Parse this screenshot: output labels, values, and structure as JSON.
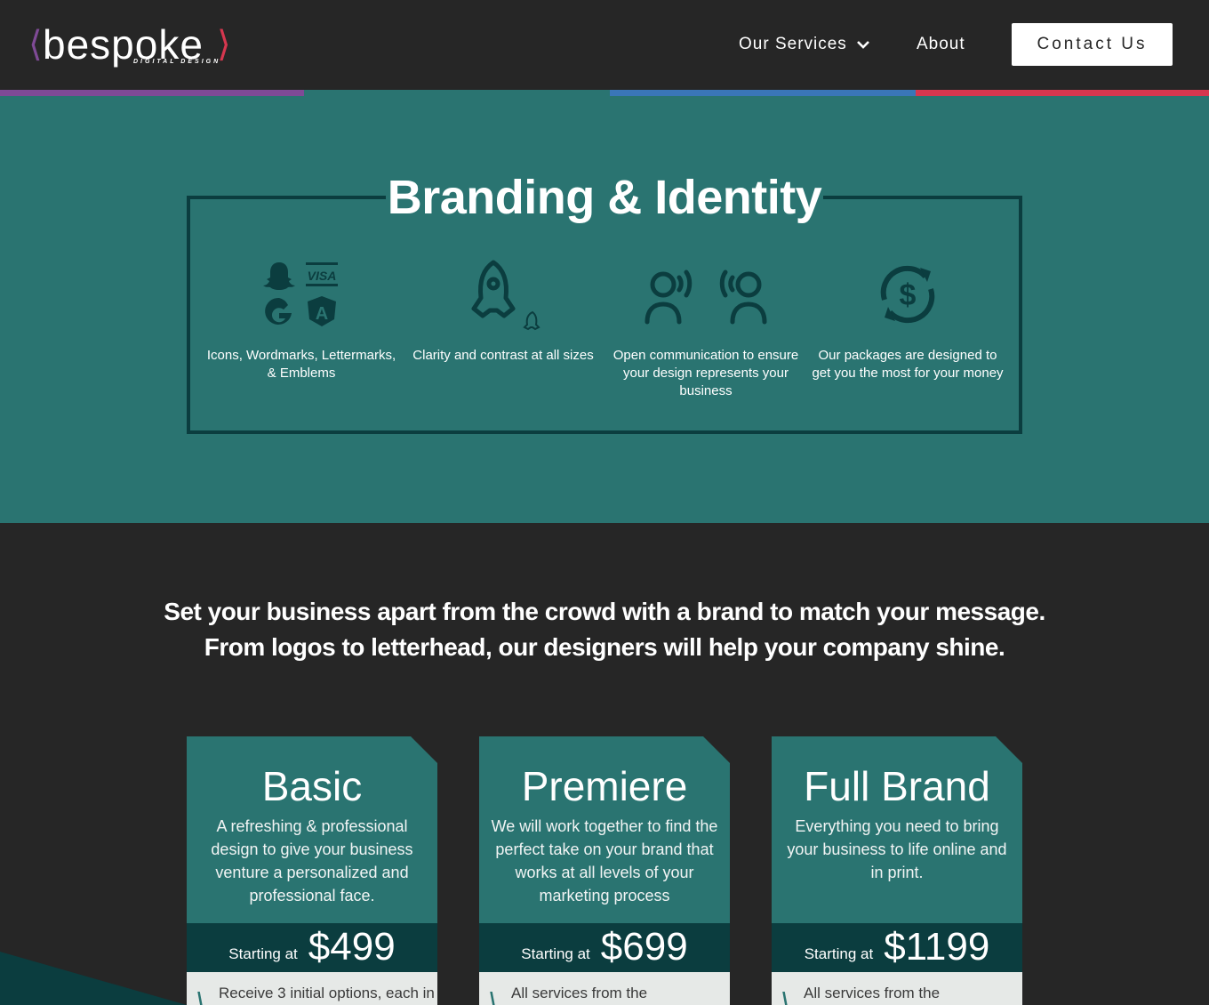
{
  "header": {
    "logo": {
      "left_bracket": "⟨",
      "word": "bespoke",
      "right_bracket": "⟩",
      "sub": "DIGITAL DESIGN"
    },
    "nav": {
      "services": "Our Services",
      "about": "About",
      "contact": "Contact Us"
    }
  },
  "colors": {
    "purple": "#7f4a96",
    "teal": "#2a7471",
    "blue": "#3a76b8",
    "red": "#d6374f",
    "dark_teal": "#0b3d3f",
    "bg": "#262626"
  },
  "hero": {
    "title": "Branding & Identity",
    "features": [
      {
        "icon": "brand-logos-icon",
        "caption": "Icons, Wordmarks, Lettermarks, & Emblems"
      },
      {
        "icon": "rocket-icon",
        "caption": "Clarity and contrast at all sizes"
      },
      {
        "icon": "people-talking-icon",
        "caption": "Open communication to ensure your design represents your business"
      },
      {
        "icon": "dollar-cycle-icon",
        "caption": "Our packages are designed to get you the most for your money"
      }
    ]
  },
  "tagline": {
    "line1": "Set your business apart from the crowd with a brand to match your message.",
    "line2": "From logos to letterhead, our designers will help your company shine."
  },
  "packages": [
    {
      "name": "Basic",
      "description": "A refreshing & professional design to give your business venture a personalized and professional face.",
      "starting_label": "Starting at",
      "price": "$499",
      "first_item": "Receive 3 initial options, each in"
    },
    {
      "name": "Premiere",
      "description": "We will work together to find the perfect take on your brand that works at all levels of your marketing process",
      "starting_label": "Starting at",
      "price": "$699",
      "first_item": "All services from the"
    },
    {
      "name": "Full Brand",
      "description": "Everything you need to bring your business to life online and in print.",
      "starting_label": "Starting at",
      "price": "$1199",
      "first_item": "All services from the"
    }
  ]
}
